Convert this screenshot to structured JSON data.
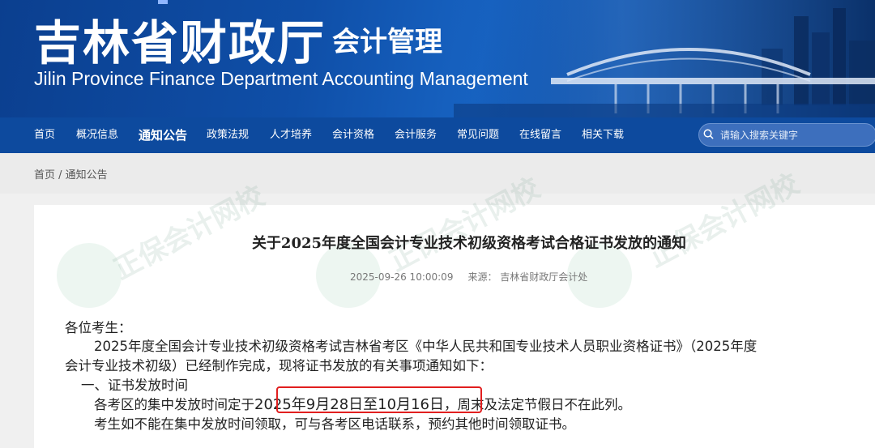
{
  "header": {
    "title": "吉林省财政厅",
    "subtitle": "会计管理",
    "english": "Jilin Province Finance Department Accounting Management"
  },
  "nav": {
    "items": [
      {
        "label": "首页",
        "active": false
      },
      {
        "label": "概况信息",
        "active": false
      },
      {
        "label": "通知公告",
        "active": true
      },
      {
        "label": "政策法规",
        "active": false
      },
      {
        "label": "人才培养",
        "active": false
      },
      {
        "label": "会计资格",
        "active": false
      },
      {
        "label": "会计服务",
        "active": false
      },
      {
        "label": "常见问题",
        "active": false
      },
      {
        "label": "在线留言",
        "active": false
      },
      {
        "label": "相关下载",
        "active": false
      }
    ],
    "search_placeholder": "请输入搜索关键字"
  },
  "breadcrumb": {
    "home": "首页",
    "sep": " / ",
    "current": "通知公告"
  },
  "article": {
    "title": "关于2025年度全国会计专业技术初级资格考试合格证书发放的通知",
    "date": "2025-09-26 10:00:09",
    "source_label": "来源：",
    "source": "吉林省财政厅会计处",
    "greeting": "各位考生：",
    "para1_line1": "2025年度全国会计专业技术初级资格考试吉林省考区《中华人民共和国专业技术人员职业资格证书》（2025年度",
    "para1_line2": "会计专业技术初级）已经制作完成，现将证书发放的有关事项通知如下：",
    "section1": "一、证书发放时间",
    "para2_prefix": "各考区的集中发放时间定于",
    "para2_dates": "2025年9月28日至10月16日",
    "para2_suffix": "，周末及法定节假日不在此列。",
    "para3": "考生如不能在集中发放时间领取，可与各考区电话联系，预约其他时间领取证书。"
  },
  "watermark": "正保会计网校"
}
